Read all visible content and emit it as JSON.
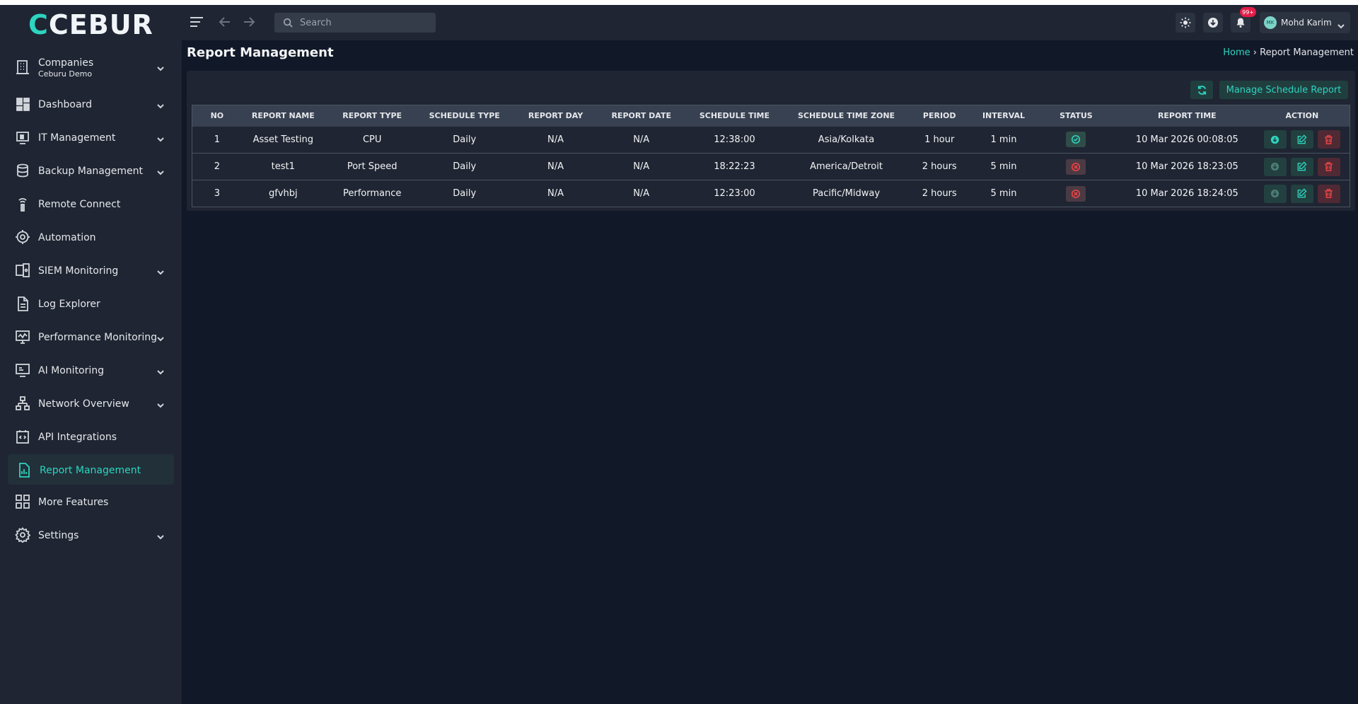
{
  "app": {
    "logo_main": "CEBUR",
    "logo_accent": "U",
    "logo_prefix": "C"
  },
  "sidebar": {
    "items": [
      {
        "label": "Companies",
        "sub": "Ceburu Demo",
        "icon": "building-icon",
        "chevron": true
      },
      {
        "label": "Dashboard",
        "icon": "dashboard-icon",
        "chevron": true
      },
      {
        "label": "IT Management",
        "icon": "it-management-icon",
        "chevron": true
      },
      {
        "label": "Backup Management",
        "icon": "database-icon",
        "chevron": true
      },
      {
        "label": "Remote Connect",
        "icon": "remote-icon",
        "chevron": false
      },
      {
        "label": "Automation",
        "icon": "gear-automation-icon",
        "chevron": false
      },
      {
        "label": "SIEM Monitoring",
        "icon": "siem-icon",
        "chevron": true
      },
      {
        "label": "Log Explorer",
        "icon": "document-icon",
        "chevron": false
      },
      {
        "label": "Performance Monitoring",
        "icon": "monitor-icon",
        "chevron": true
      },
      {
        "label": "AI Monitoring",
        "icon": "ai-monitor-icon",
        "chevron": true
      },
      {
        "label": "Network Overview",
        "icon": "network-icon",
        "chevron": true
      },
      {
        "label": "API Integrations",
        "icon": "api-icon",
        "chevron": false
      },
      {
        "label": "Report Management",
        "icon": "report-icon",
        "chevron": false,
        "active": true
      },
      {
        "label": "More Features",
        "icon": "grid-icon",
        "chevron": false
      },
      {
        "label": "Settings",
        "icon": "settings-icon",
        "chevron": true
      }
    ]
  },
  "header": {
    "search_placeholder": "Search",
    "notification_badge": "99+",
    "user_initials": "MK",
    "user_name": "Mohd Karim"
  },
  "page": {
    "title": "Report Management",
    "breadcrumb_home": "Home",
    "breadcrumb_sep": "›",
    "breadcrumb_current": "Report Management"
  },
  "toolbar": {
    "manage_label": "Manage Schedule Report"
  },
  "table": {
    "columns": [
      "NO",
      "REPORT NAME",
      "REPORT TYPE",
      "SCHEDULE TYPE",
      "REPORT DAY",
      "REPORT DATE",
      "SCHEDULE TIME",
      "SCHEDULE TIME ZONE",
      "PERIOD",
      "INTERVAL",
      "STATUS",
      "REPORT TIME",
      "ACTION"
    ],
    "rows": [
      {
        "no": "1",
        "name": "Asset Testing",
        "type": "CPU",
        "schedule_type": "Daily",
        "day": "N/A",
        "date": "N/A",
        "time": "12:38:00",
        "tz": "Asia/Kolkata",
        "period": "1 hour",
        "interval": "1 min",
        "status": "active",
        "report_time": "10 Mar 2026 00:08:05"
      },
      {
        "no": "2",
        "name": "test1",
        "type": "Port Speed",
        "schedule_type": "Daily",
        "day": "N/A",
        "date": "N/A",
        "time": "18:22:23",
        "tz": "America/Detroit",
        "period": "2 hours",
        "interval": "5 min",
        "status": "inactive",
        "report_time": "10 Mar 2026 18:23:05"
      },
      {
        "no": "3",
        "name": "gfvhbj",
        "type": "Performance",
        "schedule_type": "Daily",
        "day": "N/A",
        "date": "N/A",
        "time": "12:23:00",
        "tz": "Pacific/Midway",
        "period": "2 hours",
        "interval": "5 min",
        "status": "inactive",
        "report_time": "10 Mar 2026 18:24:05"
      }
    ]
  },
  "colors": {
    "accent": "#2dd4bf",
    "danger": "#ef4444",
    "bg": "#111827",
    "panel": "#1f2532"
  }
}
